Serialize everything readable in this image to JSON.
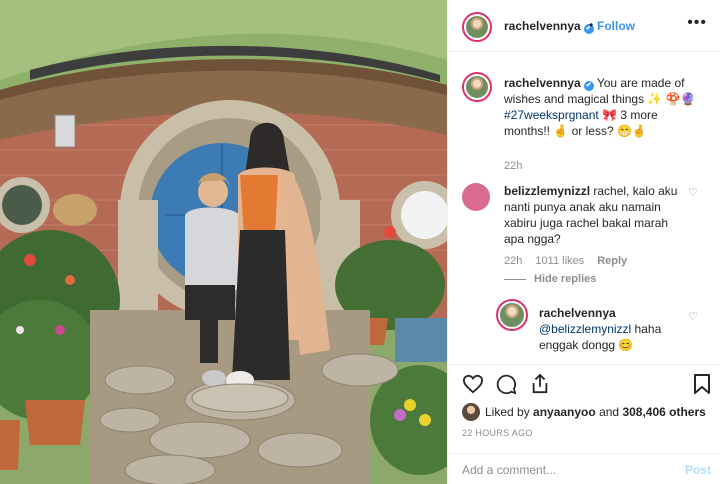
{
  "post": {
    "username": "rachelvennya",
    "dot": "•",
    "follow_label": "Follow",
    "more_icon": "more-horizontal-icon"
  },
  "caption": {
    "username": "rachelvennya",
    "text_part1": "You are made of wishes and magical things ✨",
    "emoji_line": "🍄🔮",
    "hashtag": "#27weeksprgnant",
    "text_part2": "🎀 3 more months!! 🤞 or less? 😁🤞",
    "time": "22h"
  },
  "comments": [
    {
      "username": "belizzlemynizzl",
      "text": "rachel, kalo aku nanti punya anak aku namain xabiru juga rachel bakal marah apa ngga?",
      "time": "22h",
      "likes": "1011 likes",
      "reply_label": "Reply",
      "hide_replies": "Hide replies"
    }
  ],
  "reply": {
    "username": "rachelvennya",
    "mention": "@belizzlemynizzl",
    "text": "haha enggak dongg 😊"
  },
  "footer": {
    "liked_by_prefix": "Liked by ",
    "liked_by_user": "anyaanyoo",
    "liked_by_and": " and ",
    "liked_by_count": "308,406 others",
    "time_ago": "22 HOURS AGO",
    "comment_placeholder": "Add a comment...",
    "post_label": "Post"
  },
  "colors": {
    "accent": "#3897f0",
    "link_dark": "#003569",
    "muted": "#8e8e8e",
    "post_disabled": "#b2dffc"
  }
}
